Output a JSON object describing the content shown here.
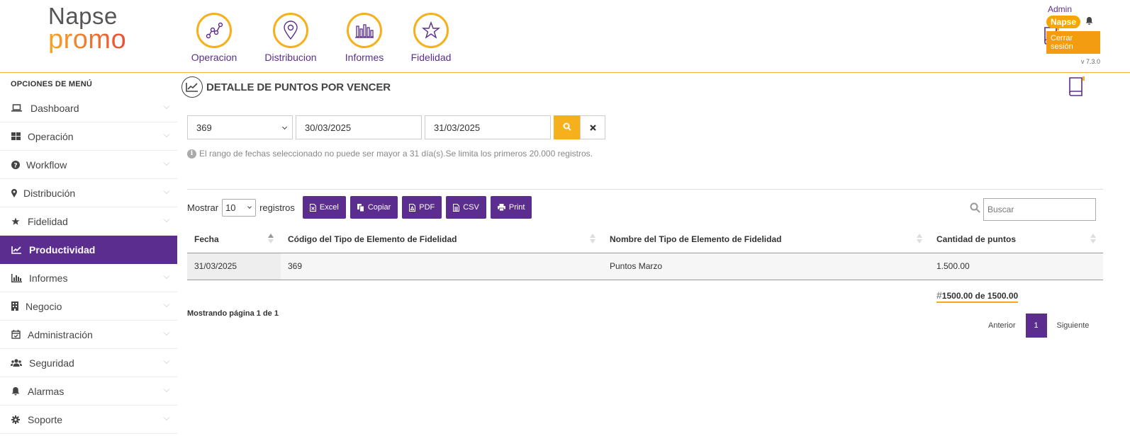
{
  "brand": {
    "line1": "Napse",
    "line2": "promo"
  },
  "topnav": [
    {
      "label": "Operacion",
      "icon": "route-icon"
    },
    {
      "label": "Distribucion",
      "icon": "map-pin-icon"
    },
    {
      "label": "Informes",
      "icon": "bar-chart-icon"
    },
    {
      "label": "Fidelidad",
      "icon": "star-icon"
    }
  ],
  "user": {
    "name": "Admin",
    "company": "Napse",
    "logout_label": "Cerrar sesión",
    "version": "v 7.3.0"
  },
  "sidebar": {
    "title": "OPCIONES DE MENÚ",
    "items": [
      {
        "label": "Dashboard",
        "icon": "laptop-icon"
      },
      {
        "label": "Operación",
        "icon": "grid-icon"
      },
      {
        "label": "Workflow",
        "icon": "question-circle-icon"
      },
      {
        "label": "Distribución",
        "icon": "map-marker-icon"
      },
      {
        "label": "Fidelidad",
        "icon": "star-icon"
      },
      {
        "label": "Productividad",
        "icon": "line-chart-icon",
        "active": true
      },
      {
        "label": "Informes",
        "icon": "bar-chart-icon"
      },
      {
        "label": "Negocio",
        "icon": "building-icon"
      },
      {
        "label": "Administración",
        "icon": "calendar-check-icon"
      },
      {
        "label": "Seguridad",
        "icon": "users-icon"
      },
      {
        "label": "Alarmas",
        "icon": "bell-icon"
      },
      {
        "label": "Soporte",
        "icon": "gear-icon"
      }
    ]
  },
  "page": {
    "title": "DETALLE DE PUNTOS POR VENCER"
  },
  "filters": {
    "type_value": "369",
    "date_from": "30/03/2025",
    "date_to": "31/03/2025",
    "hint": "El rango de fechas seleccionado no puede ser mayor a 31 día(s).Se limita los primeros 20.000 registros."
  },
  "toolbar": {
    "show_label": "Mostrar",
    "page_size": "10",
    "records_label": "registros",
    "buttons": [
      "Excel",
      "Copiar",
      "PDF",
      "CSV",
      "Print"
    ],
    "search_placeholder": "Buscar"
  },
  "table": {
    "headers": [
      "Fecha",
      "Código del Tipo de Elemento de Fidelidad",
      "Nombre del Tipo de Elemento de Fidelidad",
      "Cantidad de puntos"
    ],
    "rows": [
      [
        "31/03/2025",
        "369",
        "Puntos Marzo",
        "1.500.00"
      ]
    ]
  },
  "total": {
    "hash": "#",
    "text": "1500.00 de 1500.00"
  },
  "pagination": {
    "info": "Mostrando página 1 de 1",
    "prev": "Anterior",
    "current": "1",
    "next": "Siguiente"
  },
  "colors": {
    "brand_purple": "#5b2d8e",
    "accent_orange": "#f5b01b"
  }
}
